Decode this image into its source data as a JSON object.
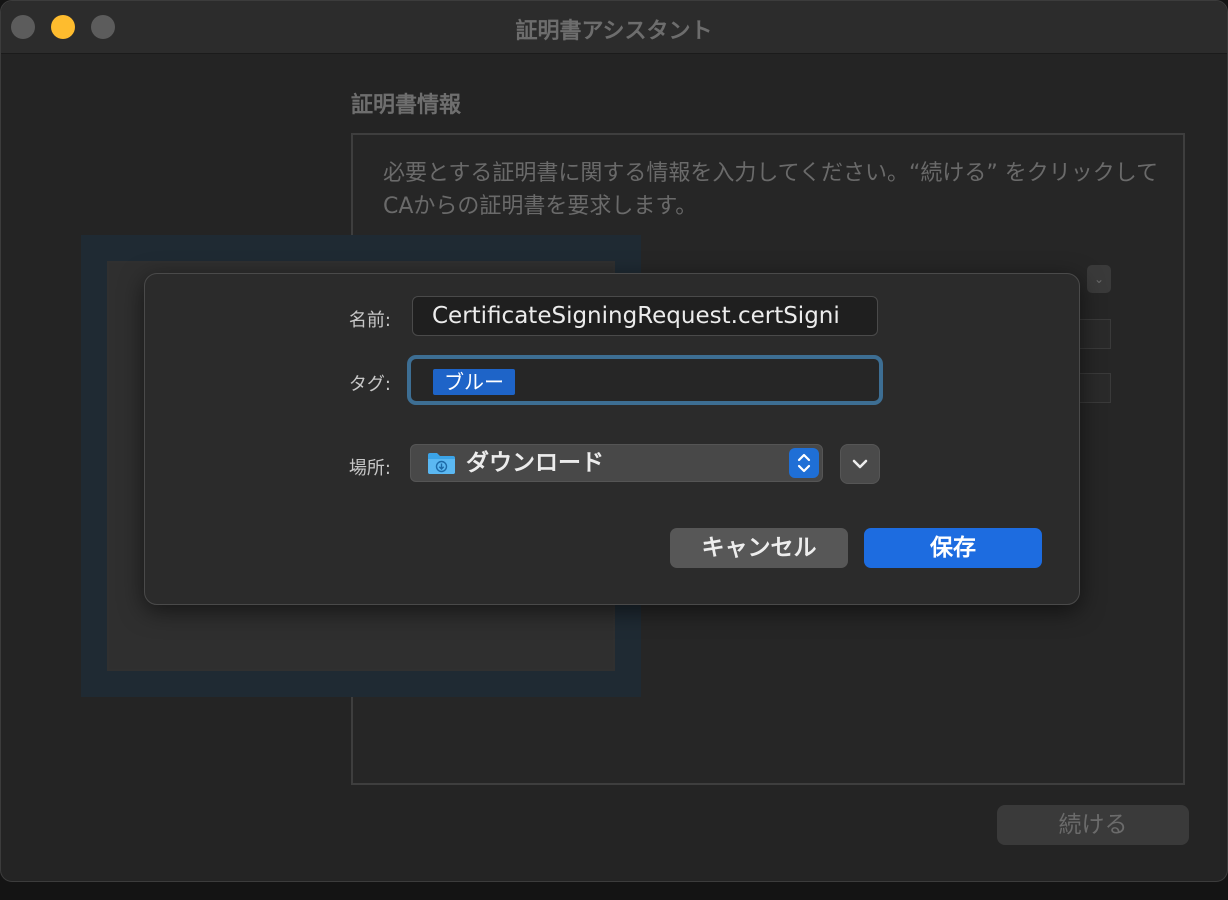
{
  "window": {
    "title": "証明書アシスタント"
  },
  "assistant": {
    "section_title": "証明書情報",
    "description": "必要とする証明書に関する情報を入力してください。“続ける” をクリックしてCAからの証明書を要求します。",
    "continue_label": "続ける"
  },
  "save_sheet": {
    "name_label": "名前:",
    "name_value": "CertificateSigningRequest.certSigni",
    "tags_label": "タグ:",
    "tags": [
      "ブルー"
    ],
    "location_label": "場所:",
    "location_value": "ダウンロード",
    "cancel_label": "キャンセル",
    "save_label": "保存"
  },
  "colors": {
    "accent": "#1d6ce0",
    "tag_blue": "#1e64c8",
    "minimize_yellow": "#febc2e"
  },
  "icons": {
    "location": "downloads-folder-icon",
    "location_stepper": "up-down-chevron-icon",
    "expand": "chevron-down-icon"
  }
}
